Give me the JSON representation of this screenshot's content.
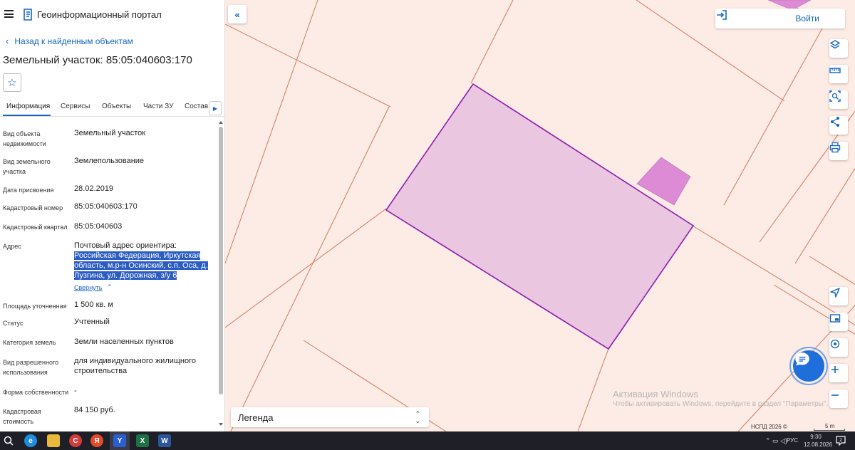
{
  "header": {
    "app_title": "Геоинформационный портал"
  },
  "nav": {
    "back_label": "Назад к найденным объектам"
  },
  "object": {
    "title": "Земельный участок: 85:05:040603:170"
  },
  "tabs": [
    {
      "label": "Информация"
    },
    {
      "label": "Сервисы"
    },
    {
      "label": "Объекты"
    },
    {
      "label": "Части ЗУ"
    },
    {
      "label": "Состав"
    }
  ],
  "properties": {
    "object_type": {
      "label_l1": "Вид объекта",
      "label_l2": "недвижимости",
      "value": "Земельный участок"
    },
    "land_type": {
      "label_l1": "Вид земельного",
      "label_l2": "участка",
      "value": "Землепользование"
    },
    "assign_date": {
      "label": "Дата присвоения",
      "value": "28.02.2019"
    },
    "cadastral_number": {
      "label": "Кадастровый номер",
      "value": "85:05:040603:170"
    },
    "cadastral_quarter": {
      "label": "Кадастровый квартал",
      "value": "85:05:040603"
    },
    "address": {
      "label": "Адрес",
      "value_intro": "Почтовый адрес ориентира:",
      "value_lines": [
        "Российская Федерация, Иркутская",
        "область, м.р-н Осинский, с.п. Оса, д.",
        "Лузгина, ул. Дорожная, з/у 6"
      ],
      "collapse_label": "Свернуть"
    },
    "area": {
      "label": "Площадь уточненная",
      "value": "1 500 кв. м"
    },
    "status": {
      "label": "Статус",
      "value": "Учтенный"
    },
    "land_category": {
      "label": "Категория земель",
      "value": "Земли населенных пунктов"
    },
    "permitted_use": {
      "label_l1": "Вид разрешенного",
      "label_l2": "использования",
      "value_l1": "для индивидуального жилищного",
      "value_l2": "строительства"
    },
    "ownership": {
      "label": "Форма собственности",
      "value": "-"
    },
    "cadastral_value": {
      "label_l1": "Кадастровая",
      "label_l2": "стоимость",
      "value": "84 150 руб."
    }
  },
  "map": {
    "login_label": "Войти",
    "legend_label": "Легенда",
    "watermark_title": "Активация Windows",
    "watermark_text": "Чтобы активировать Windows, перейдите в раздел \"Параметры\".",
    "copyright": "НСПД 2026 ©",
    "scale_label": "5 m",
    "parcel_fill": "#ebc6e1",
    "parcel_stroke": "#8a1fb0",
    "building_fill": "#de8bd6",
    "line_color": "#d07a5a"
  },
  "taskbar": {
    "language": "РУС",
    "time": "9:30",
    "date": "12.08.2026",
    "apps": [
      "search-icon",
      "edge-icon",
      "file-explorer-icon",
      "ccleaner-icon",
      "yandex-browser-icon",
      "yandex-icon",
      "excel-icon",
      "word-icon"
    ]
  }
}
